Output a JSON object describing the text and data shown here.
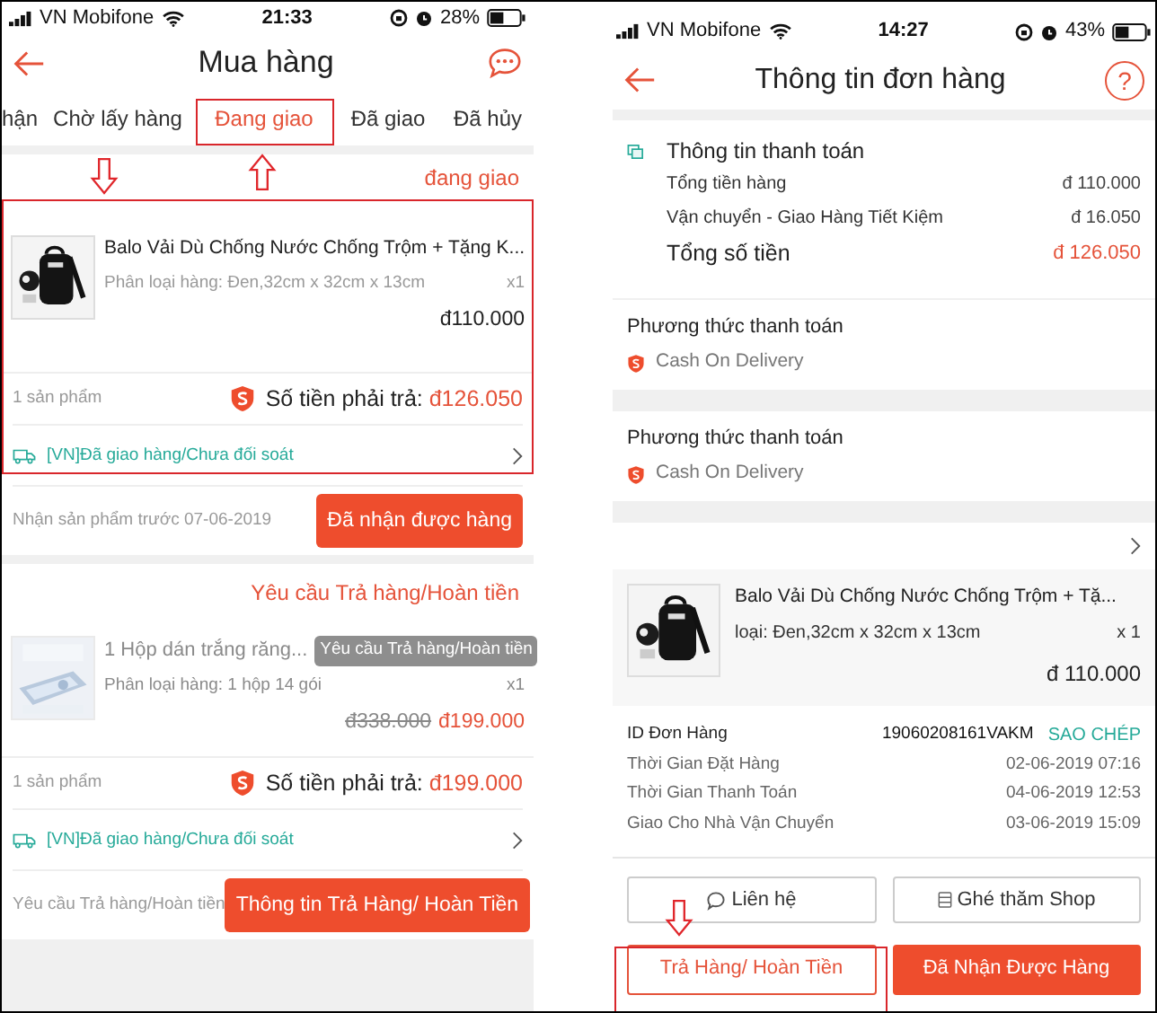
{
  "left_screen": {
    "status_bar": {
      "carrier": "VN Mobifone",
      "time": "21:33",
      "battery": "28%"
    },
    "header": {
      "title": "Mua hàng"
    },
    "tabs": [
      {
        "label": "hận",
        "selected": false
      },
      {
        "label": "Chờ lấy hàng",
        "selected": false
      },
      {
        "label": "Đang giao",
        "selected": true
      },
      {
        "label": "Đã giao",
        "selected": false
      },
      {
        "label": "Đã hủy",
        "selected": false
      }
    ],
    "orders": [
      {
        "status": "đang giao",
        "product": {
          "name": "Balo Vải Dù Chống Nước Chống Trộm + Tặng K...",
          "variant": "Phân loại hàng: Đen,32cm x 32cm x 13cm",
          "quantity": "x1",
          "price": "đ110.000",
          "disabled": false
        },
        "item_count": "1 sản phẩm",
        "total_label": "Số tiền phải trả:",
        "total": "đ126.050",
        "shipping": "[VN]Đã giao hàng/Chưa đối soát",
        "note": "Nhận sản phẩm trước 07-06-2019",
        "action": "Đã nhận được hàng"
      },
      {
        "status": "Yêu cầu Trả hàng/Hoàn tiền",
        "product": {
          "name": "1 Hộp dán trắng răng...",
          "badge": "Yêu cầu Trả hàng/Hoàn tiền",
          "variant": "Phân loại hàng: 1 hộp 14 gói",
          "quantity": "x1",
          "original_price": "đ338.000",
          "price": "đ199.000",
          "disabled": true
        },
        "item_count": "1 sản phẩm",
        "total_label": "Số tiền phải trả:",
        "total": "đ199.000",
        "shipping": "[VN]Đã giao hàng/Chưa đối soát",
        "note": "Yêu cầu Trả hàng/Hoàn tiền",
        "action": "Thông tin Trả Hàng/ Hoàn Tiền"
      }
    ]
  },
  "right_screen": {
    "status_bar": {
      "carrier": "VN Mobifone",
      "time": "14:27",
      "battery": "43%"
    },
    "header": {
      "title": "Thông tin đơn hàng",
      "help": "?"
    },
    "payment_info": {
      "title": "Thông tin thanh toán",
      "rows": [
        {
          "kind": "item",
          "label": "Tổng tiền hàng",
          "value": "đ 110.000"
        },
        {
          "kind": "item",
          "label": "Vận chuyển - Giao Hàng Tiết Kiệm",
          "value": "đ 16.050"
        },
        {
          "kind": "total",
          "label": "Tổng số tiền",
          "value": "đ 126.050"
        }
      ]
    },
    "payment_methods": [
      {
        "title": "Phương thức thanh toán",
        "method": "Cash On Delivery"
      },
      {
        "title": "Phương thức thanh toán",
        "method": "Cash On Delivery"
      }
    ],
    "product": {
      "name": "Balo Vải Dù Chống Nước Chống Trộm + Tặ...",
      "variant": "loại: Đen,32cm x 32cm x 13cm",
      "quantity": "x 1",
      "price": "đ 110.000"
    },
    "order_details": [
      {
        "label": "ID Đơn Hàng",
        "value": "19060208161VAKM",
        "action": "SAO CHÉP"
      },
      {
        "label": "Thời Gian Đặt Hàng",
        "value": "02-06-2019 07:16"
      },
      {
        "label": "Thời Gian Thanh Toán",
        "value": "04-06-2019 12:53"
      },
      {
        "label": "Giao Cho Nhà Vận Chuyển",
        "value": "03-06-2019 15:09"
      }
    ],
    "buttons": [
      {
        "kind": "chat",
        "label": "Liên hệ"
      },
      {
        "kind": "shop",
        "label": "Ghé thăm Shop"
      },
      {
        "kind": "outline",
        "label": "Trả Hàng/ Hoàn Tiền"
      },
      {
        "kind": "primary",
        "label": "Đã Nhận Được Hàng"
      }
    ]
  }
}
